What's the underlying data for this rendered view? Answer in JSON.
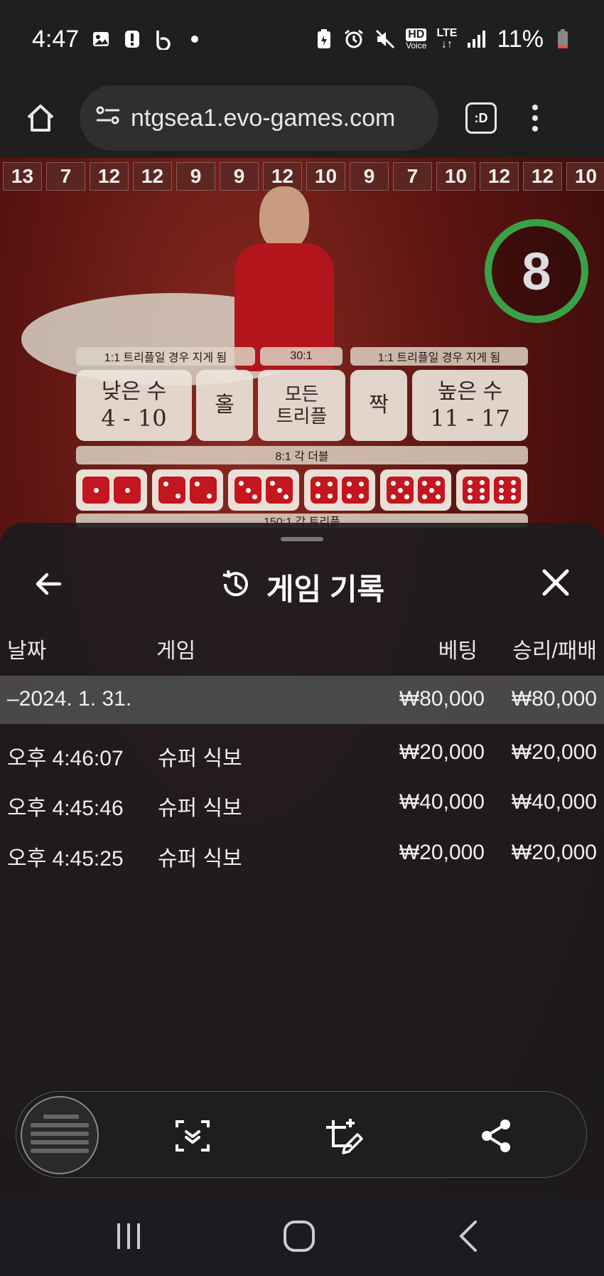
{
  "status_bar": {
    "time": "4:47",
    "battery": "11%",
    "left_icons": [
      "image-icon",
      "alert-icon",
      "b-app-icon",
      "dot-icon"
    ],
    "right_icons": [
      "battery-saver-icon",
      "alarm-icon",
      "mute-icon",
      "hd-voice-icon",
      "lte-icon",
      "signal-icon",
      "battery-icon"
    ],
    "hd_label": "HD",
    "voice_label": "Voice",
    "lte_label": "LTE"
  },
  "browser": {
    "url": "ntgsea1.evo-games.com",
    "tab_label": ":D"
  },
  "game": {
    "history": [
      "13",
      "7",
      "12",
      "12",
      "9",
      "9",
      "12",
      "10",
      "9",
      "7",
      "10",
      "12",
      "12",
      "10"
    ],
    "timer": "8",
    "labels": {
      "left_payout": "1:1 트리플일 경우 지게 됨",
      "center_payout": "30:1",
      "right_payout": "1:1 트리플일 경우 지게 됨",
      "double_payout": "8:1 각 더블",
      "triple_payout": "150:1 각 트리플"
    },
    "bets": {
      "small_label": "낮은 수",
      "small_range": "4 - 10",
      "odd": "홀",
      "any_triple_line1": "모든",
      "any_triple_line2": "트리플",
      "even": "짝",
      "big_label": "높은 수",
      "big_range": "11 - 17"
    },
    "doubles": [
      1,
      2,
      3,
      4,
      5,
      6
    ]
  },
  "sheet": {
    "title": "게임 기록",
    "columns": {
      "date": "날짜",
      "game": "게임",
      "bet": "베팅",
      "result": "승리/패배"
    },
    "date_group": {
      "date": "–2024. 1. 31.",
      "bet": "₩80,000",
      "result": "₩80,000"
    },
    "rows": [
      {
        "time": "오후 4:46:07",
        "game": "슈퍼 식보",
        "bet": "₩20,000",
        "result": "₩20,000"
      },
      {
        "time": "오후 4:45:46",
        "game": "슈퍼 식보",
        "bet": "₩40,000",
        "result": "₩40,000"
      },
      {
        "time": "오후 4:45:25",
        "game": "슈퍼 식보",
        "bet": "₩20,000",
        "result": "₩20,000"
      }
    ]
  },
  "screenshot_toolbar": {
    "icons": [
      "thumbnail-preview",
      "scroll-capture-icon",
      "crop-edit-icon",
      "share-icon"
    ]
  },
  "nav_bar": {
    "icons": [
      "recent-apps-icon",
      "home-icon",
      "back-icon"
    ]
  }
}
